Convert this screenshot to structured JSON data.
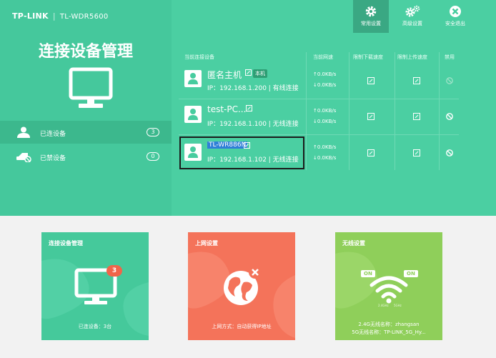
{
  "brand": {
    "logo": "TP-LINK",
    "separator": "|",
    "model": "TL-WDR5600"
  },
  "left_panel": {
    "title": "连接设备管理",
    "items": [
      {
        "label": "已连设备",
        "count": "3",
        "icon": "user-icon"
      },
      {
        "label": "已禁设备",
        "count": "0",
        "icon": "blocked-device-icon"
      }
    ]
  },
  "nav": [
    {
      "label": "常用设置",
      "icon": "gear-icon"
    },
    {
      "label": "高级设置",
      "icon": "gears-icon"
    },
    {
      "label": "安全退出",
      "icon": "close-icon"
    }
  ],
  "table": {
    "headers": [
      "当前连接设备",
      "当前网速",
      "限制下载速度",
      "限制上传速度",
      "禁用"
    ],
    "rows": [
      {
        "name": "匿名主机",
        "tag": "本机",
        "ip": "IP：192.168.1.200 | 有线连接",
        "up": "↑0.0KB/s",
        "down": "↓0.0KB/s"
      },
      {
        "name": "test-PC...",
        "tag": "",
        "ip": "IP：192.168.1.100 | 无线连接",
        "up": "↑0.0KB/s",
        "down": "↓0.0KB/s"
      },
      {
        "name": "TL-WR886N",
        "tag": "",
        "ip": "IP：192.168.1.102 | 无线连接",
        "up": "↑0.0KB/s",
        "down": "↓0.0KB/s"
      }
    ]
  },
  "cards": [
    {
      "title": "连接设备管理",
      "footer": "已连设备：3台",
      "badge": "3",
      "color": "#45c99b"
    },
    {
      "title": "上网设置",
      "footer": "上网方式：自动获得IP地址",
      "color": "#f4735a"
    },
    {
      "title": "无线设置",
      "footer1": "2.4G无线名称：zhangsan",
      "footer2": "5G无线名称：TP-LINK_5G_Hy...",
      "on1": "ON",
      "on2": "ON",
      "band1": "2.4GHz",
      "band2": "5GHz",
      "color": "#8fcf5a"
    }
  ]
}
